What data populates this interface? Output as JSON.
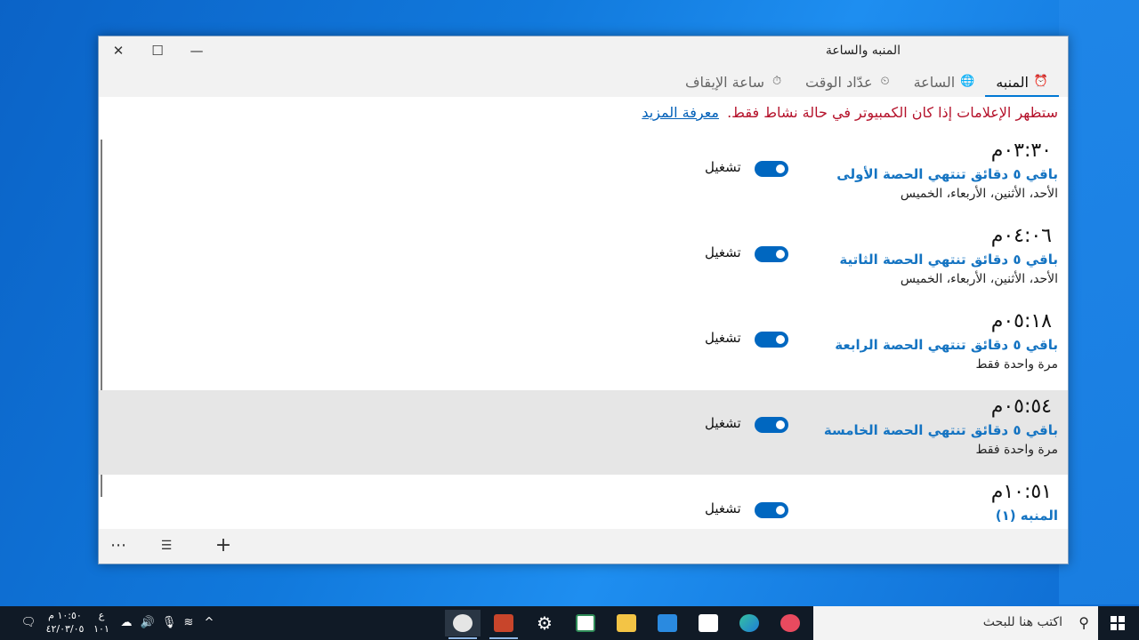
{
  "window": {
    "title": "المنبه والساعة",
    "controls": {
      "close": "✕",
      "maximize": "☐",
      "minimize": "—"
    }
  },
  "tabs": [
    {
      "label": "المنبه",
      "icon": "alarm-clock-icon",
      "active": true
    },
    {
      "label": "الساعة",
      "icon": "world-clock-icon",
      "active": false
    },
    {
      "label": "عدّاد الوقت",
      "icon": "timer-icon",
      "active": false
    },
    {
      "label": "ساعة الإيقاف",
      "icon": "stopwatch-icon",
      "active": false
    }
  ],
  "notice": {
    "text": "ستظهر الإعلامات إذا كان الكمبيوتر في حالة نشاط فقط.",
    "link": "معرفة المزيد"
  },
  "alarms": [
    {
      "time": "٠٣:٣٠م",
      "name": "باقي ٥ دقائق تنتهي الحصة الأولى",
      "days": "الأحد، الأثنين، الأربعاء، الخميس",
      "state_label": "تشغيل",
      "on": true
    },
    {
      "time": "٠٤:٠٦م",
      "name": "باقي ٥ دقائق تنتهي الحصة الثاتية",
      "days": "الأحد، الأثنين، الأربعاء، الخميس",
      "state_label": "تشغيل",
      "on": true
    },
    {
      "time": "٠٥:١٨م",
      "name": "باقي ٥ دقائق تنتهي الحصة الرابعة",
      "days": "مرة واحدة فقط",
      "state_label": "تشغيل",
      "on": true
    },
    {
      "time": "٠٥:٥٤م",
      "name": "باقي ٥ دقائق تنتهي الحصة الخامسة",
      "days": "مرة واحدة فقط",
      "state_label": "تشغيل",
      "on": true
    },
    {
      "time": "١٠:٥١م",
      "name": "المنبه (١)",
      "days": "",
      "state_label": "تشغيل",
      "on": true
    }
  ],
  "commandbar": {
    "more": "⋯",
    "select": "☰",
    "add": "+"
  },
  "taskbar": {
    "search_placeholder": "اكتب هنا للبحث",
    "clock_time": "١٠:٥٠ م",
    "clock_date": "٤٢/٠٣/٠٥",
    "lang_top": "ع",
    "lang_bottom": "١٠١",
    "colors": {
      "accent": "#0067c0",
      "taskbar": "#101a26"
    }
  }
}
